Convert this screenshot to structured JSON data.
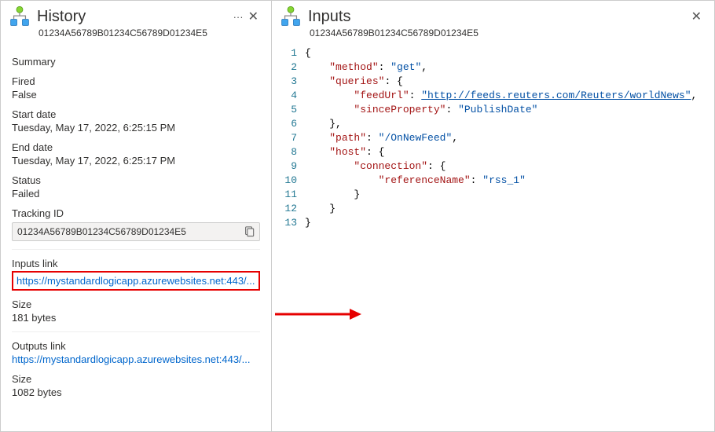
{
  "left": {
    "title": "History",
    "id": "01234A56789B01234C56789D01234E5",
    "summary_label": "Summary",
    "fired_label": "Fired",
    "fired_value": "False",
    "start_label": "Start date",
    "start_value": "Tuesday, May 17, 2022, 6:25:15 PM",
    "end_label": "End date",
    "end_value": "Tuesday, May 17, 2022, 6:25:17 PM",
    "status_label": "Status",
    "status_value": "Failed",
    "tracking_label": "Tracking ID",
    "tracking_value": "01234A56789B01234C56789D01234E5",
    "inputs_link_label": "Inputs link",
    "inputs_link_value": "https://mystandardlogicapp.azurewebsites.net:443/...",
    "inputs_size_label": "Size",
    "inputs_size_value": "181 bytes",
    "outputs_link_label": "Outputs link",
    "outputs_link_value": "https://mystandardlogicapp.azurewebsites.net:443/...",
    "outputs_size_label": "Size",
    "outputs_size_value": "1082 bytes"
  },
  "right": {
    "title": "Inputs",
    "id": "01234A56789B01234C56789D01234E5",
    "json": {
      "method": "get",
      "queries": {
        "feedUrl": "http://feeds.reuters.com/Reuters/worldNews",
        "sinceProperty": "PublishDate"
      },
      "path": "/OnNewFeed",
      "host": {
        "connection": {
          "referenceName": "rss_1"
        }
      }
    }
  },
  "icons": {
    "ellipsis": "···",
    "close": "✕"
  }
}
